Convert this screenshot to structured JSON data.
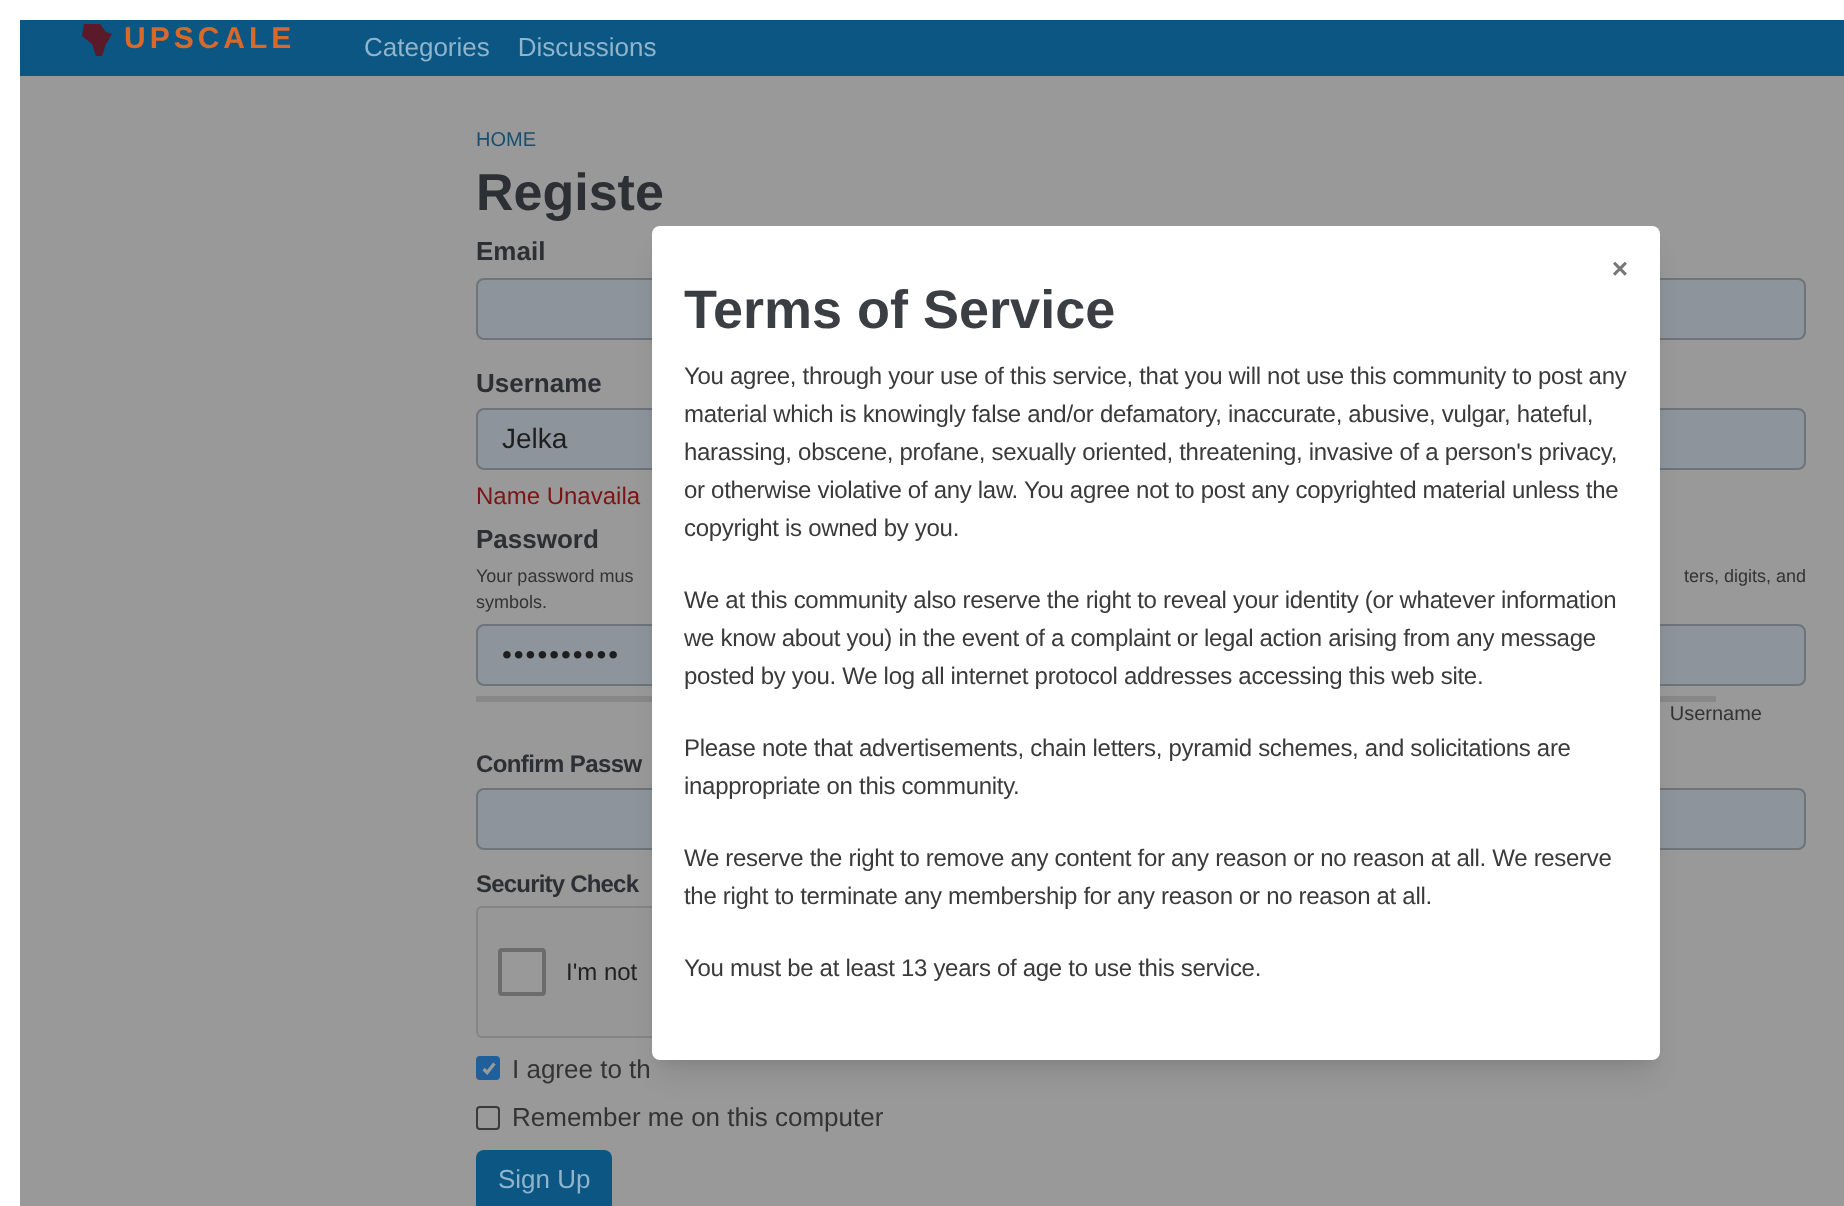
{
  "header": {
    "logo": "UPSCALE",
    "nav": [
      {
        "label": "Categories"
      },
      {
        "label": "Discussions"
      }
    ]
  },
  "breadcrumb": "HOME",
  "form": {
    "title": "Registe",
    "email": {
      "label": "Email"
    },
    "username": {
      "label": "Username",
      "value": "Jelka",
      "error": "Name Unavaila"
    },
    "password": {
      "label": "Password",
      "hint_left": "Your password mus",
      "hint_right": "ters, digits, and",
      "hint_line2": "symbols.",
      "value": "••••••••••",
      "note_right": "Username"
    },
    "confirm": {
      "label": "Confirm Passw"
    },
    "security": {
      "label": "Security Check",
      "captcha_text": "I'm not",
      "checked": false
    },
    "agree": {
      "label": "I agree to th",
      "checked": true
    },
    "remember": {
      "label": "Remember me on this computer",
      "checked": false
    },
    "submit": "Sign Up"
  },
  "modal": {
    "close": "×",
    "title": "Terms of Service",
    "paragraphs": [
      "You agree, through your use of this service, that you will not use this community to post any material which is knowingly false and/or defamatory, inaccurate, abusive, vulgar, hateful, harassing, obscene, profane, sexually oriented, threatening, invasive of a person's privacy, or otherwise violative of any law. You agree not to post any copyrighted material unless the copyright is owned by you.",
      "We at this community also reserve the right to reveal your identity (or whatever information we know about you) in the event of a complaint or legal action arising from any message posted by you. We log all internet protocol addresses accessing this web site.",
      "Please note that advertisements, chain letters, pyramid schemes, and solicitations are inappropriate on this community.",
      "We reserve the right to remove any content for any reason or no reason at all. We reserve the right to terminate any membership for any reason or no reason at all.",
      "You must be at least 13 years of age to use this service."
    ]
  }
}
